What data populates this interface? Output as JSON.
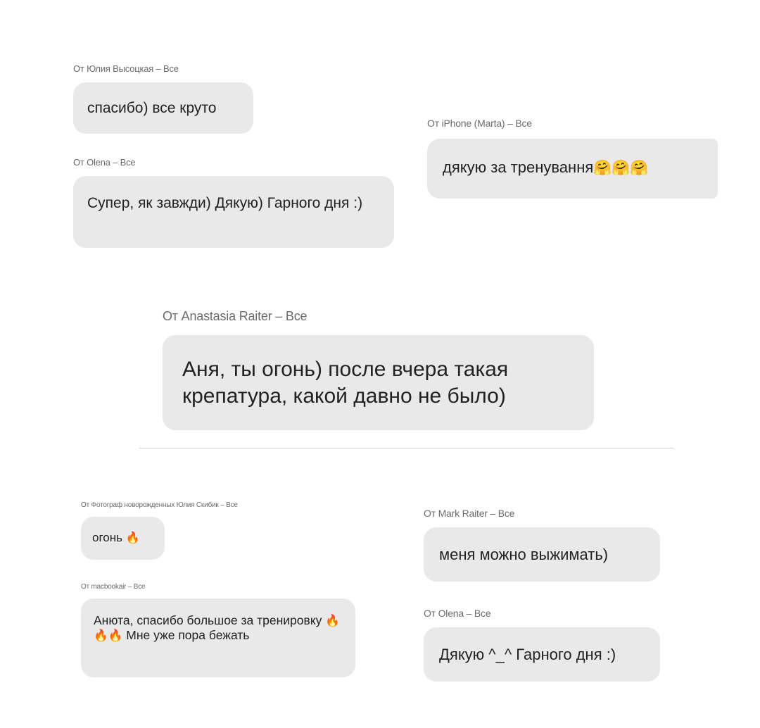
{
  "messages": [
    {
      "sender": "От Юлия Высоцкая – Все",
      "text": "спасибо) все круто"
    },
    {
      "sender": "От Olena – Все",
      "text": "Супер, як завжди) Дякую) Гарного дня :)"
    },
    {
      "sender": "От iPhone (Marta) – Все",
      "text": "дякую за тренування",
      "emoji": "🤗🤗🤗"
    },
    {
      "sender": "От Anastasia Raiter – Все",
      "text": "Аня, ты огонь) после вчера такая крепатура, какой давно не было)"
    },
    {
      "sender": "От Фотограф новорожденных Юлия Скибик – Все",
      "text": "огонь",
      "emoji": "🔥"
    },
    {
      "sender": "От macbookair – Все",
      "text_before": "Анюта, спасибо большое за тренировку",
      "emoji": "🔥🔥🔥",
      "text_after": "Мне уже пора бежать"
    },
    {
      "sender": "От Mark Raiter – Все",
      "text": "меня можно выжимать)"
    },
    {
      "sender": "От Olena – Все",
      "text": "Дякую ^_^ Гарного дня :)"
    }
  ]
}
